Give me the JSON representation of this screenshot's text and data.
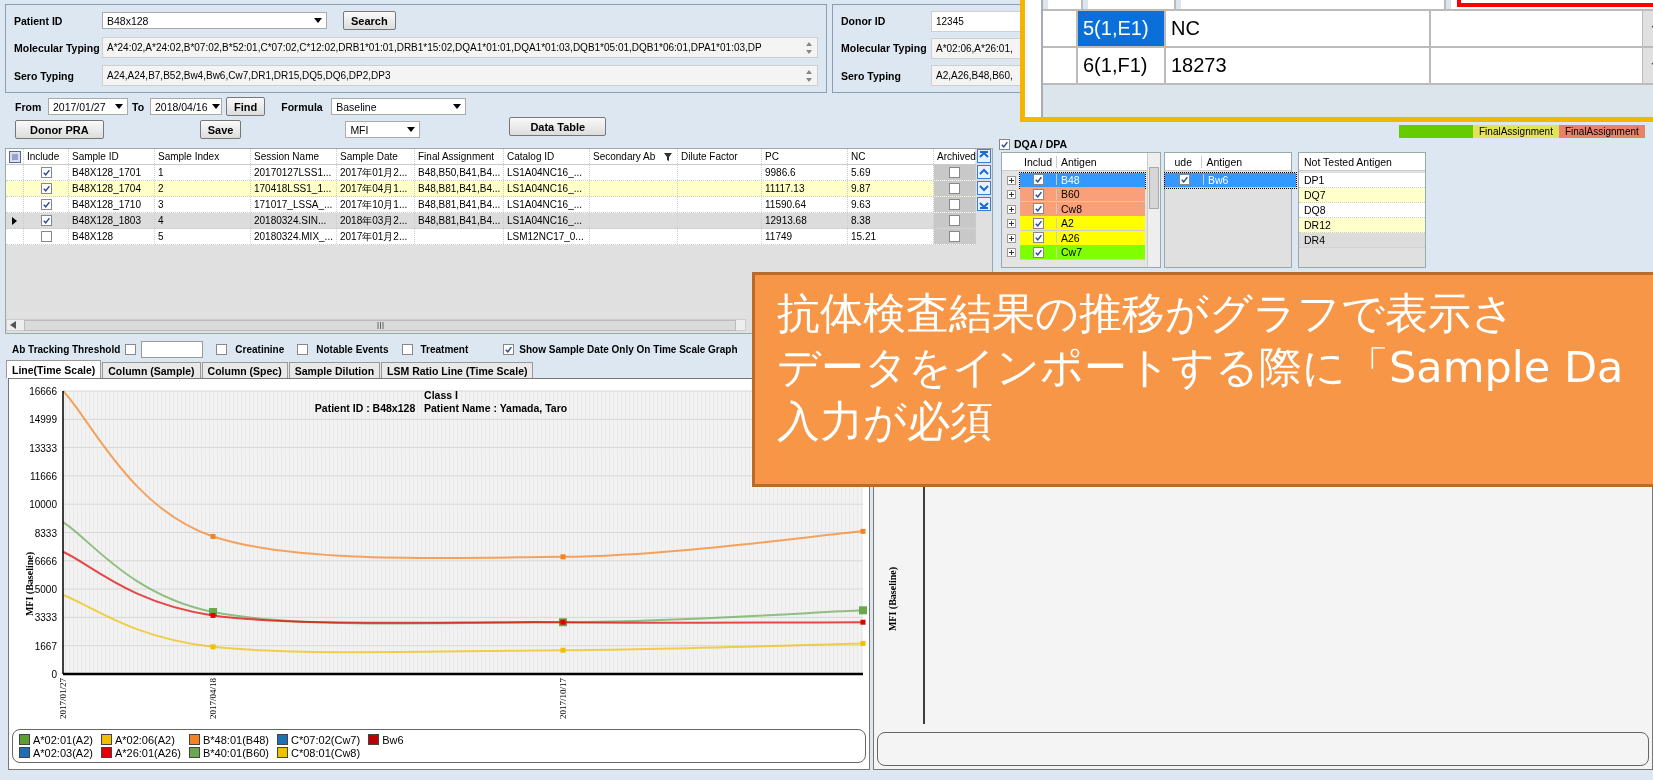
{
  "patient": {
    "id_label": "Patient ID",
    "id_value": "B48x128",
    "search": "Search",
    "molecular_label": "Molecular Typing",
    "molecular_value": "A*24:02,A*24:02,B*07:02,B*52:01,C*07:02,C*12:02,DRB1*01:01,DRB1*15:02,DQA1*01:01,DQA1*01:03,DQB1*05:01,DQB1*06:01,DPA1*01:03,DP",
    "sero_label": "Sero Typing",
    "sero_value": "A24,A24,B7,B52,Bw4,Bw6,Cw7,DR1,DR15,DQ5,DQ6,DP2,DP3"
  },
  "donor": {
    "id_label": "Donor ID",
    "id_value": "12345",
    "molecular_label": "Molecular Typing",
    "molecular_value": "A*02:06,A*26:01,",
    "sero_label": "Sero Typing",
    "sero_value": "A2,A26,B48,B60,"
  },
  "filters": {
    "from_label": "From",
    "from_value": "2017/01/27",
    "to_label": "To",
    "to_value": "2018/04/16",
    "find": "Find",
    "formula_label": "Formula",
    "formula_value": "Baseline",
    "measure_value": "MFI",
    "donor_pra": "Donor PRA",
    "save": "Save",
    "data_table": "Data Table"
  },
  "dqa_dpa": {
    "label": "DQA / DPA",
    "checked": true
  },
  "assignment_legend": [
    {
      "color": "#66cc00"
    },
    {
      "label": "FinalAssignment",
      "color": "#e3e35a"
    },
    {
      "label": "FinalAssignment",
      "color": "#e8836a"
    }
  ],
  "samples": {
    "columns": [
      "Include",
      "Sample ID",
      "Sample Index",
      "Session Name",
      "Sample Date",
      "Final Assignment",
      "Catalog ID",
      "Secondary Ab",
      "Dilute Factor",
      "PC",
      "NC",
      "Archived"
    ],
    "rows": [
      {
        "selected": false,
        "highlighted": false,
        "include": true,
        "archived": false,
        "sample_id": "B48X128_1701",
        "sample_index": "1",
        "session_name": "20170127LSS1...",
        "sample_date": "2017年01月2...",
        "final_assignment": "B48,B50,B41,B4...",
        "catalog_id": "LS1A04NC16_...",
        "pc": "9986.6",
        "nc": "5.69"
      },
      {
        "selected": false,
        "highlighted": true,
        "include": true,
        "archived": false,
        "sample_id": "B48X128_1704",
        "sample_index": "2",
        "session_name": "170418LSS1_1...",
        "sample_date": "2017年04月1...",
        "final_assignment": "B48,B81,B41,B4...",
        "catalog_id": "LS1A04NC16_...",
        "pc": "11117.13",
        "nc": "9.87"
      },
      {
        "selected": false,
        "highlighted": false,
        "include": true,
        "archived": false,
        "sample_id": "B48X128_1710",
        "sample_index": "3",
        "session_name": "171017_LSSA_...",
        "sample_date": "2017年10月1...",
        "final_assignment": "B48,B81,B41,B4...",
        "catalog_id": "LS1A04NC16_...",
        "pc": "11590.64",
        "nc": "9.63"
      },
      {
        "selected": true,
        "highlighted": false,
        "include": true,
        "archived": false,
        "sample_id": "B48X128_1803",
        "sample_index": "4",
        "session_name": "20180324.SIN...",
        "sample_date": "2018年03月2...",
        "final_assignment": "B48,B81,B41,B4...",
        "catalog_id": "LS1A04NC16_...",
        "pc": "12913.68",
        "nc": "8.38"
      },
      {
        "selected": false,
        "highlighted": false,
        "include": false,
        "archived": false,
        "sample_id": "B48X128",
        "sample_index": "5",
        "session_name": "20180324.MIX_...",
        "sample_date": "2017年01月2...",
        "catalog_id": "LSM12NC17_0...",
        "pc": "11749",
        "nc": "15.21"
      }
    ]
  },
  "antigens": {
    "include_header": "Includ",
    "antigen_header": "Antigen",
    "rows": [
      {
        "name": "B48",
        "include": true,
        "selected": true,
        "color": "#3399ff"
      },
      {
        "name": "B60",
        "include": true,
        "selected": false,
        "color": "#f9a07a"
      },
      {
        "name": "Cw8",
        "include": true,
        "selected": false,
        "color": "#f9a07a"
      },
      {
        "name": "A2",
        "include": true,
        "selected": false,
        "color": "#ffff00"
      },
      {
        "name": "A26",
        "include": true,
        "selected": false,
        "color": "#ffff00"
      },
      {
        "name": "Cw7",
        "include": true,
        "selected": false,
        "color": "#80ff00"
      }
    ]
  },
  "other_antigens": {
    "include_header": "ude",
    "antigen_header": "Antigen",
    "rows": [
      {
        "name": "Bw6",
        "include": true,
        "selected": true
      }
    ]
  },
  "not_tested": {
    "header": "Not Tested Antigen",
    "rows": [
      {
        "name": "DP1",
        "color": "#ffffff"
      },
      {
        "name": "DQ7",
        "color": "#ffffcc"
      },
      {
        "name": "DQ8",
        "color": "#ffffff"
      },
      {
        "name": "DR12",
        "color": "#ffffcc"
      },
      {
        "name": "DR4",
        "color": "#dcdcdc"
      }
    ]
  },
  "thresholds": {
    "label": "Ab Tracking Threshold",
    "checked": false,
    "options": [
      {
        "label": "Creatinine",
        "checked": false
      },
      {
        "label": "Notable Events",
        "checked": false
      },
      {
        "label": "Treatment",
        "checked": false
      },
      {
        "label": "Show Sample Date Only On Time Scale Graph",
        "checked": true
      }
    ]
  },
  "tabs": [
    {
      "label": "Line(Time Scale)",
      "selected": true
    },
    {
      "label": "Column (Sample)",
      "selected": false
    },
    {
      "label": "Column (Spec)",
      "selected": false
    },
    {
      "label": "Sample Dilution",
      "selected": false
    },
    {
      "label": "LSM Ratio Line (Time Scale)",
      "selected": false
    }
  ],
  "chart": {
    "chart_data": {
      "type": "line",
      "title": "Class I",
      "subtitle": "Patient ID : B48x128   Patient Name : Yamada, Taro",
      "ylabel": "MFI (Baseline)",
      "categories": [
        "2017/01/27",
        null,
        null,
        "2017/04/18",
        null,
        null,
        null,
        null,
        null,
        null,
        "2017/10/17",
        null,
        null,
        null,
        null,
        null,
        null
      ],
      "grid": true,
      "legend": true,
      "ylim": [
        0,
        16666
      ],
      "yticks": [
        0,
        1667,
        3333,
        5000,
        6666,
        8333,
        10000,
        11666,
        13333,
        14999,
        16666
      ],
      "series": [
        {
          "name": "A*02:01(A2)",
          "color": "#5e9e2e",
          "values": [
            null,
            null,
            null,
            null,
            null,
            null,
            null,
            null,
            null,
            null,
            null,
            null,
            null,
            null,
            null,
            null,
            null
          ]
        },
        {
          "name": "A*02:06(A2)",
          "color": "#f0c000",
          "values": [
            null,
            null,
            null,
            null,
            null,
            null,
            null,
            null,
            null,
            null,
            null,
            null,
            null,
            null,
            null,
            null,
            null
          ]
        },
        {
          "name": "B*48:01(B48)",
          "color": "#f58220",
          "values": [
            16666,
            null,
            null,
            8100,
            null,
            null,
            null,
            null,
            null,
            null,
            6900,
            null,
            null,
            null,
            null,
            null,
            8400
          ]
        },
        {
          "name": "C*07:02(Cw7)",
          "color": "#1f6fb5",
          "values": [
            null,
            null,
            null,
            null,
            null,
            null,
            null,
            null,
            null,
            null,
            null,
            null,
            null,
            null,
            null,
            null,
            null
          ]
        },
        {
          "name": "Bw6",
          "color": "#c00000",
          "values": [
            null,
            null,
            null,
            null,
            null,
            null,
            null,
            null,
            null,
            null,
            null,
            null,
            null,
            null,
            null,
            null,
            null
          ]
        },
        {
          "name": "A*02:03(A2)",
          "color": "#1f6fb5",
          "values": [
            null,
            null,
            null,
            null,
            null,
            null,
            null,
            null,
            null,
            null,
            null,
            null,
            null,
            null,
            null,
            null,
            null
          ]
        },
        {
          "name": "A*26:01(A26)",
          "color": "#e00000",
          "values": [
            7200,
            null,
            null,
            3450,
            null,
            null,
            null,
            null,
            null,
            null,
            3050,
            null,
            null,
            null,
            null,
            null,
            3050
          ]
        },
        {
          "name": "B*40:01(B60)",
          "color": "#6aa84f",
          "values": [
            8950,
            null,
            null,
            3650,
            null,
            null,
            null,
            null,
            null,
            null,
            3050,
            null,
            null,
            null,
            null,
            null,
            3750
          ]
        },
        {
          "name": "C*08:01(Cw8)",
          "color": "#f0c000",
          "values": [
            4650,
            null,
            null,
            1600,
            null,
            null,
            null,
            null,
            null,
            null,
            1400,
            null,
            null,
            null,
            null,
            null,
            1800
          ]
        }
      ]
    }
  },
  "second_chart": {
    "ylabel": "MFI (Baseline)"
  },
  "dialog_grid": {
    "rows": [
      {
        "index": "5(1,E1)",
        "value": "NC",
        "selected": true
      },
      {
        "index": "6(1,F1)",
        "value": "18273",
        "selected": false
      }
    ]
  },
  "callout": {
    "lines": [
      "抗体検査結果の推移がグラフで表示さ",
      "データをインポートする際に「Sample Da",
      "入力が必須"
    ]
  }
}
